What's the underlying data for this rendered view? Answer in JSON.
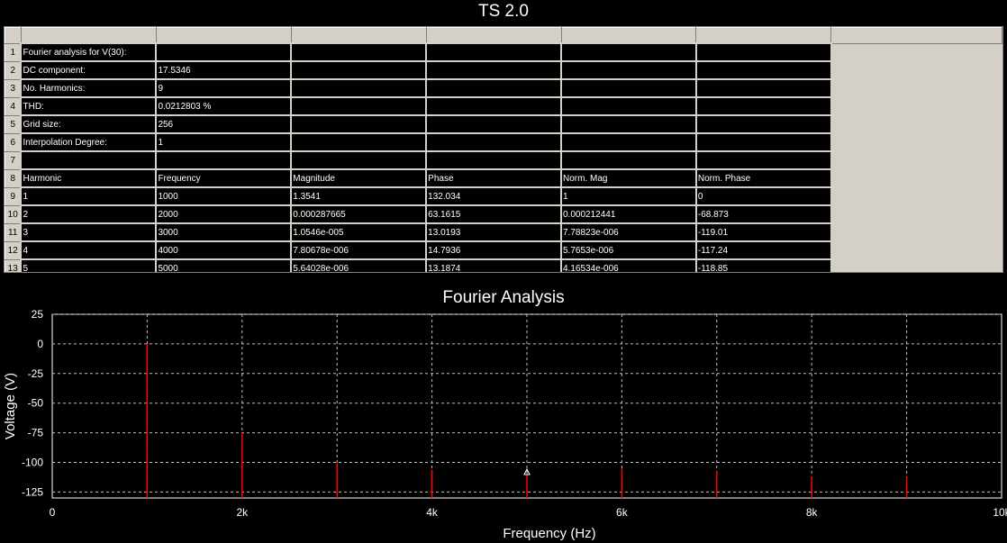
{
  "window": {
    "title": "TS 2.0"
  },
  "sheet": {
    "row_numbers": [
      "1",
      "2",
      "3",
      "4",
      "5",
      "6",
      "7",
      "8",
      "9",
      "10",
      "11",
      "12",
      "13"
    ],
    "rows": [
      [
        "Fourier analysis for V(30):",
        "",
        "",
        "",
        "",
        ""
      ],
      [
        "DC component:",
        "17.5346",
        "",
        "",
        "",
        ""
      ],
      [
        "No. Harmonics:",
        "9",
        "",
        "",
        "",
        ""
      ],
      [
        "THD:",
        "0.0212803 %",
        "",
        "",
        "",
        ""
      ],
      [
        "Grid size:",
        "256",
        "",
        "",
        "",
        ""
      ],
      [
        "Interpolation Degree:",
        "1",
        "",
        "",
        "",
        ""
      ],
      [
        "",
        "",
        "",
        "",
        "",
        ""
      ],
      [
        "Harmonic",
        "Frequency",
        "Magnitude",
        "Phase",
        "Norm. Mag",
        "Norm. Phase"
      ],
      [
        "1",
        "1000",
        "1.3541",
        "132.034",
        "1",
        "0"
      ],
      [
        "2",
        "2000",
        "0.000287665",
        "63.1615",
        "0.000212441",
        "-68.873"
      ],
      [
        "3",
        "3000",
        "1.0546e-005",
        "13.0193",
        "7.78823e-006",
        "-119.01"
      ],
      [
        "4",
        "4000",
        "7.80678e-006",
        "14.7936",
        "5.7653e-006",
        "-117.24"
      ],
      [
        "5",
        "5000",
        "5.64028e-006",
        "13.1874",
        "4.16534e-006",
        "-118.85"
      ]
    ]
  },
  "chart_data": {
    "type": "bar",
    "title": "Fourier Analysis",
    "xlabel": "Frequency (Hz)",
    "ylabel": "Voltage (V)",
    "xlim": [
      0,
      10000
    ],
    "ylim": [
      -130,
      25
    ],
    "x_ticks": [
      0,
      2000,
      4000,
      6000,
      8000,
      10000
    ],
    "x_tick_labels": [
      "0",
      "2k",
      "4k",
      "6k",
      "8k",
      "10k"
    ],
    "y_ticks": [
      25,
      0,
      -25,
      -50,
      -75,
      -100,
      -125
    ],
    "y_tick_labels": [
      "25",
      "0",
      "-25",
      "-50",
      "-75",
      "-100",
      "-125"
    ],
    "grid": true,
    "series": [
      {
        "x": [
          1000,
          2000,
          3000,
          4000,
          5000,
          6000,
          7000,
          8000,
          9000
        ],
        "values": [
          0,
          -75,
          -101,
          -106,
          -110,
          -105,
          -107,
          -112,
          -112
        ],
        "color": "#ff0000"
      }
    ],
    "marker": {
      "x": 5000,
      "y": -108
    }
  },
  "colors": {
    "background": "#000000",
    "grid": "#c0c0c0",
    "bars": "#ff0000",
    "chrome": "#d4d0c8"
  }
}
